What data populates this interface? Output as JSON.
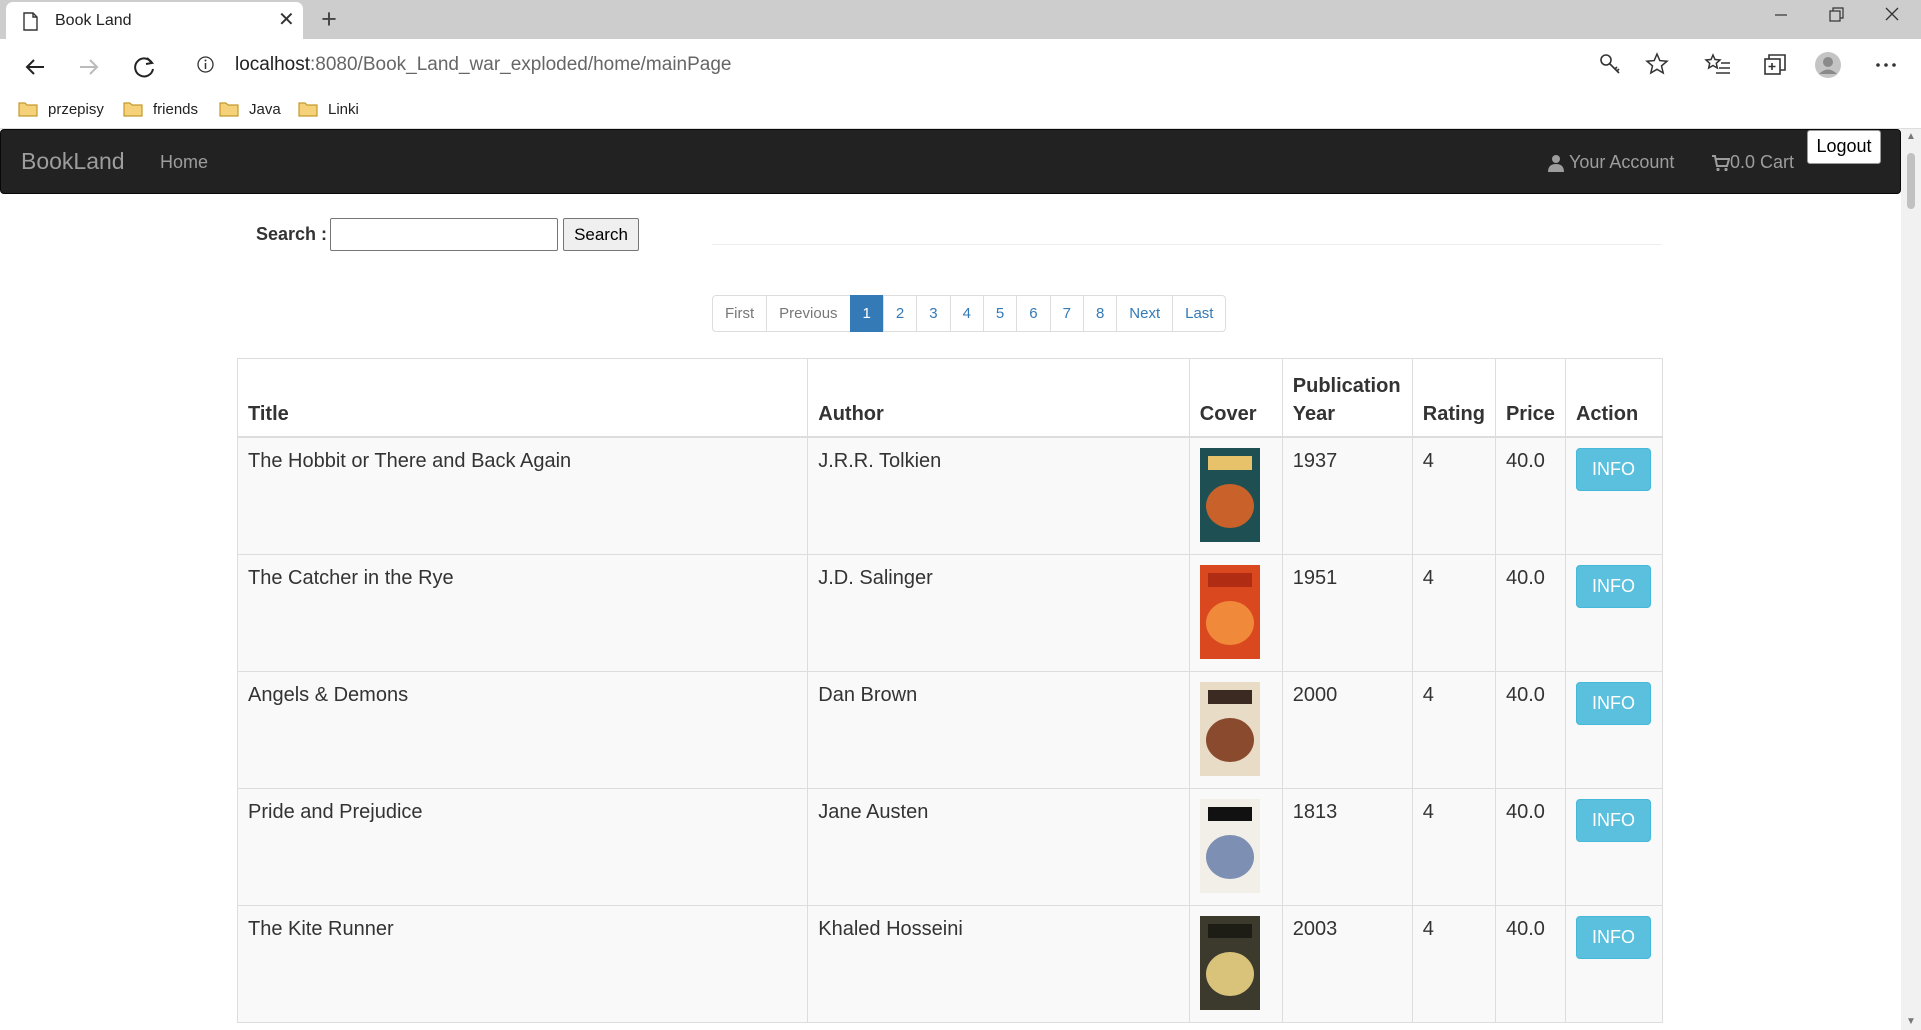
{
  "browser": {
    "tab_title": "Book Land",
    "url_host": "localhost",
    "url_path": ":8080/Book_Land_war_exploded/home/mainPage",
    "bookmarks": [
      {
        "label": "przepisy"
      },
      {
        "label": "friends"
      },
      {
        "label": "Java"
      },
      {
        "label": "Linki"
      }
    ]
  },
  "navbar": {
    "brand": "BookLand",
    "home": "Home",
    "account": "Your Account",
    "cart": "0.0 Cart",
    "logout": "Logout"
  },
  "search": {
    "label": "Search :",
    "value": "",
    "button": "Search"
  },
  "pagination": {
    "first": "First",
    "previous": "Previous",
    "pages": [
      "1",
      "2",
      "3",
      "4",
      "5",
      "6",
      "7",
      "8"
    ],
    "active_page": "1",
    "next": "Next",
    "last": "Last"
  },
  "table": {
    "headers": {
      "title": "Title",
      "author": "Author",
      "cover": "Cover",
      "year_line1": "Publication",
      "year_line2": "Year",
      "rating": "Rating",
      "price": "Price",
      "action": "Action"
    },
    "rows": [
      {
        "title": "The Hobbit or There and Back Again",
        "author": "J.R.R. Tolkien",
        "year": "1937",
        "rating": "4",
        "price": "40.0",
        "action": "INFO",
        "cover_colors": [
          "#1e4f52",
          "#c9622a",
          "#e8c26a"
        ]
      },
      {
        "title": "The Catcher in the Rye",
        "author": "J.D. Salinger",
        "year": "1951",
        "rating": "4",
        "price": "40.0",
        "action": "INFO",
        "cover_colors": [
          "#d9481f",
          "#f08a3a",
          "#b02d14"
        ]
      },
      {
        "title": "Angels & Demons",
        "author": "Dan Brown",
        "year": "2000",
        "rating": "4",
        "price": "40.0",
        "action": "INFO",
        "cover_colors": [
          "#e9dcc7",
          "#8a4a2e",
          "#3a2a22"
        ]
      },
      {
        "title": "Pride and Prejudice",
        "author": "Jane Austen",
        "year": "1813",
        "rating": "4",
        "price": "40.0",
        "action": "INFO",
        "cover_colors": [
          "#f2efe8",
          "#7d8fb2",
          "#111111"
        ]
      },
      {
        "title": "The Kite Runner",
        "author": "Khaled Hosseini",
        "year": "2003",
        "rating": "4",
        "price": "40.0",
        "action": "INFO",
        "cover_colors": [
          "#3b3a2c",
          "#d9c37a",
          "#1d1c15"
        ]
      }
    ]
  }
}
